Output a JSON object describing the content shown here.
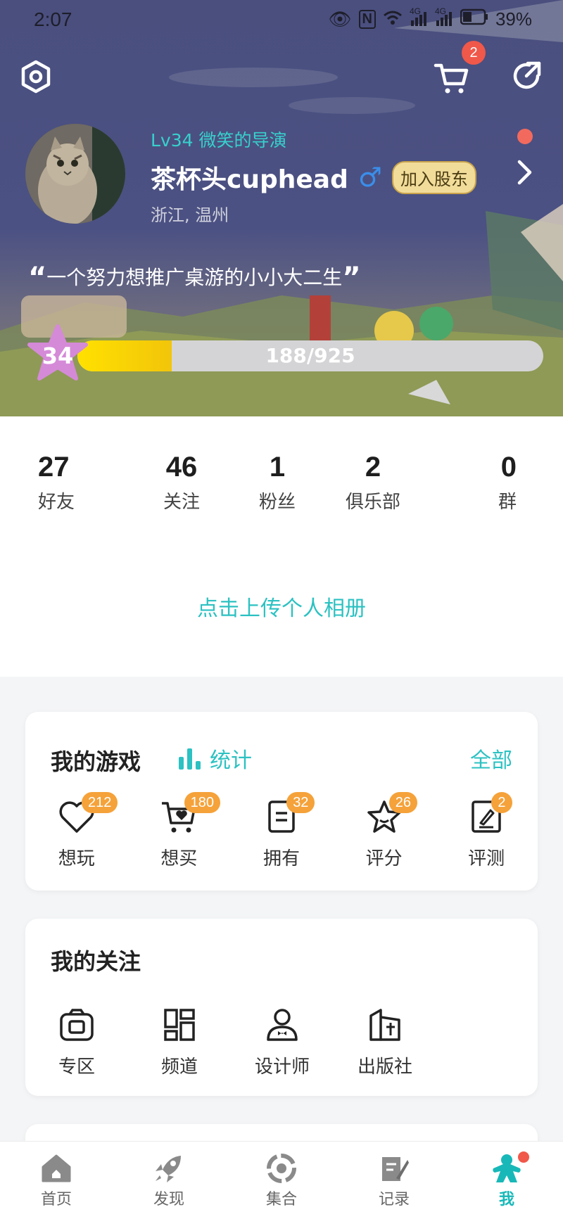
{
  "status_bar": {
    "time": "2:07",
    "signal_4g_1": "4G",
    "signal_4g_2": "4G",
    "battery": "39%"
  },
  "header": {
    "cart_badge": "2",
    "level_title": "Lv34 微笑的导演",
    "username": "茶杯头cuphead",
    "gender_symbol": "♂",
    "shareholder_button": "加入股东",
    "location": "浙江, 温州",
    "motto": "一个努力想推广桌游的小小大二生",
    "level_number": "34",
    "xp_text": "188/925",
    "xp_fraction": 0.203
  },
  "stats": [
    {
      "count": "27",
      "label": "好友"
    },
    {
      "count": "46",
      "label": "关注"
    },
    {
      "count": "1",
      "label": "粉丝"
    },
    {
      "count": "2",
      "label": "俱乐部"
    },
    {
      "count": "0",
      "label": "群"
    }
  ],
  "upload_album": "点击上传个人相册",
  "my_games": {
    "title": "我的游戏",
    "stats_link": "统计",
    "all_link": "全部",
    "items": [
      {
        "label": "想玩",
        "count": "212",
        "icon": "heart-icon"
      },
      {
        "label": "想买",
        "count": "180",
        "icon": "cart-heart-icon"
      },
      {
        "label": "拥有",
        "count": "32",
        "icon": "document-icon"
      },
      {
        "label": "评分",
        "count": "26",
        "icon": "star-icon"
      },
      {
        "label": "评测",
        "count": "2",
        "icon": "review-icon"
      }
    ]
  },
  "my_follows": {
    "title": "我的关注",
    "items": [
      {
        "label": "专区",
        "icon": "zone-icon"
      },
      {
        "label": "频道",
        "icon": "channel-icon"
      },
      {
        "label": "设计师",
        "icon": "designer-icon"
      },
      {
        "label": "出版社",
        "icon": "publisher-icon"
      }
    ]
  },
  "tabbar": [
    {
      "label": "首页",
      "icon": "home-icon"
    },
    {
      "label": "发现",
      "icon": "rocket-icon"
    },
    {
      "label": "集合",
      "icon": "collection-icon"
    },
    {
      "label": "记录",
      "icon": "record-icon"
    },
    {
      "label": "我",
      "icon": "meeple-icon",
      "active": true
    }
  ],
  "colors": {
    "accent": "#2cc1c2",
    "badge_red": "#f0584a",
    "badge_orange": "#f5a23a",
    "header_bg": "#4b5183"
  }
}
